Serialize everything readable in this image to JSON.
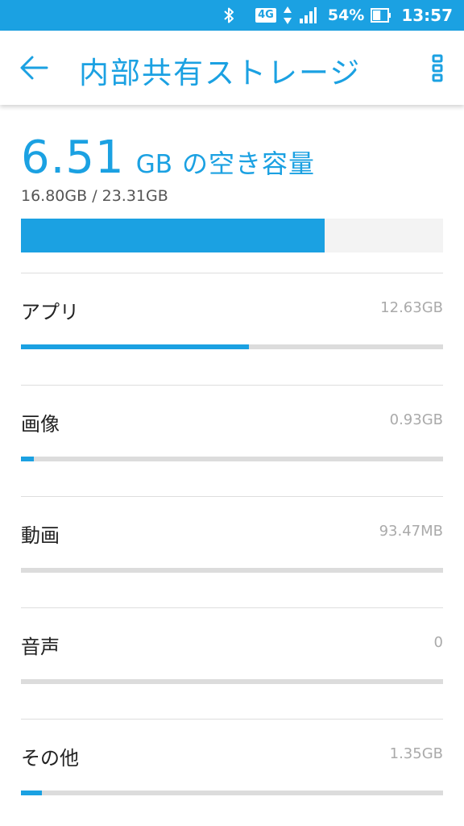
{
  "status_bar": {
    "network": "4G",
    "battery_percent": "54%",
    "battery_level": 0.54,
    "time": "13:57",
    "icons": [
      "bluetooth-icon",
      "data-arrows-icon",
      "signal-icon",
      "battery-icon"
    ]
  },
  "app_bar": {
    "title": "内部共有ストレージ",
    "back_icon": "arrow-left-icon",
    "menu_icon": "more-vert-icon"
  },
  "summary": {
    "free_value": "6.51",
    "free_unit": "GB",
    "free_label": "の空き容量",
    "used_text": "16.80GB / 23.31GB",
    "used_fraction": 0.72
  },
  "categories": [
    {
      "label": "アプリ",
      "size": "12.63GB",
      "fraction": 0.54
    },
    {
      "label": "画像",
      "size": "0.93GB",
      "fraction": 0.03
    },
    {
      "label": "動画",
      "size": "93.47MB",
      "fraction": 0.0
    },
    {
      "label": "音声",
      "size": "0",
      "fraction": 0.0
    },
    {
      "label": "その他",
      "size": "1.35GB",
      "fraction": 0.05
    }
  ],
  "colors": {
    "accent": "#1ba1e2",
    "track": "#dcdcdc"
  }
}
